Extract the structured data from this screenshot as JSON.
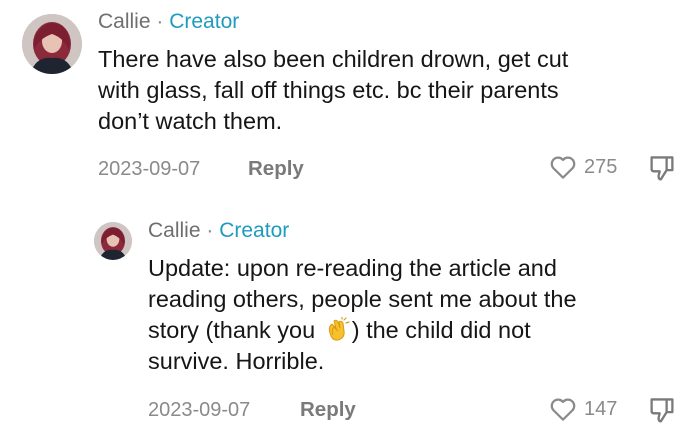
{
  "comments": [
    {
      "author": "Callie",
      "separator": "·",
      "badge": "Creator",
      "text_lines": [
        "There have also been children drown, get cut",
        "with glass, fall off things etc. bc their parents",
        "don’t watch them."
      ],
      "date": "2023-09-07",
      "reply_label": "Reply",
      "likes": "275",
      "avatar_icon": "user-avatar"
    },
    {
      "author": "Callie",
      "separator": "·",
      "badge": "Creator",
      "text_lines": [
        "Update: upon re-reading the article and",
        "reading others, people sent me about the",
        "story (thank you ",
        ") the child did not",
        "survive. Horrible."
      ],
      "emoji_icon": "clapping-hands-emoji",
      "date": "2023-09-07",
      "reply_label": "Reply",
      "likes": "147",
      "avatar_icon": "user-avatar"
    }
  ],
  "colors": {
    "badge": "#1f9bbf",
    "author": "#6f6f6f",
    "muted": "#8a8a8a",
    "text": "#161616"
  }
}
